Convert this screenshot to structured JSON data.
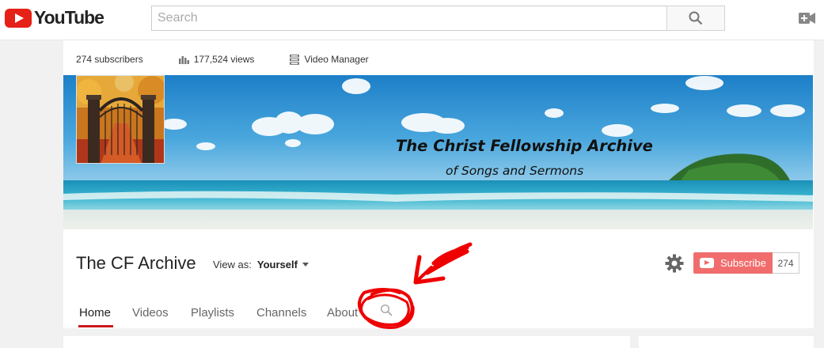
{
  "header": {
    "logo_text": "YouTube",
    "search_placeholder": "Search"
  },
  "stats": {
    "subscribers": "274 subscribers",
    "views": "177,524 views",
    "video_manager": "Video Manager"
  },
  "banner": {
    "title": "The Christ Fellowship Archive",
    "subtitle": "of Songs and Sermons"
  },
  "channel": {
    "name": "The CF Archive",
    "view_as_label": "View as:",
    "view_as_value": "Yourself",
    "subscribe_label": "Subscribe",
    "subscriber_count": "274"
  },
  "tabs": [
    {
      "label": "Home",
      "active": true
    },
    {
      "label": "Videos",
      "active": false
    },
    {
      "label": "Playlists",
      "active": false
    },
    {
      "label": "Channels",
      "active": false
    },
    {
      "label": "About",
      "active": false
    }
  ],
  "colors": {
    "brand_red": "#e62117",
    "subscribe_bg": "#f16d6d",
    "tab_underline": "#cc181e",
    "annotation_red": "#ee0000"
  },
  "icons": [
    "youtube-logo-icon",
    "search-icon",
    "upload-video-icon",
    "stats-bars-icon",
    "video-manager-icon",
    "gear-icon",
    "channel-search-icon"
  ]
}
